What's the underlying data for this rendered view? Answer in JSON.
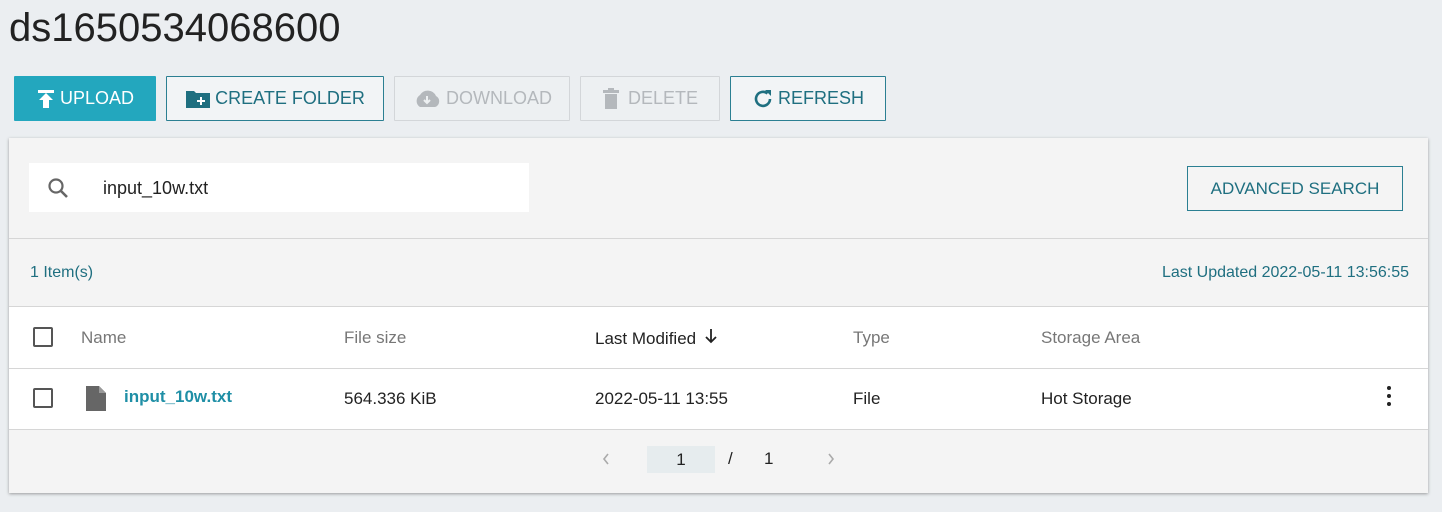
{
  "page": {
    "title": "ds1650534068600"
  },
  "toolbar": {
    "upload_label": "UPLOAD",
    "create_folder_label": "CREATE FOLDER",
    "download_label": "DOWNLOAD",
    "delete_label": "DELETE",
    "refresh_label": "REFRESH"
  },
  "search": {
    "value": "input_10w.txt",
    "advanced_label": "ADVANCED SEARCH",
    "icon": "search-icon"
  },
  "summary": {
    "item_count": "1 Item(s)",
    "last_updated": "Last Updated 2022-05-11 13:56:55"
  },
  "table": {
    "columns": {
      "name": "Name",
      "file_size": "File size",
      "last_modified": "Last Modified",
      "type": "Type",
      "storage_area": "Storage Area"
    },
    "sort_icon": "arrow-down-icon",
    "rows": [
      {
        "name": "input_10w.txt",
        "file_size": "564.336 KiB",
        "last_modified": "2022-05-11 13:55",
        "type": "File",
        "storage_area": "Hot Storage",
        "icon": "file-icon"
      }
    ]
  },
  "pagination": {
    "current": "1",
    "separator": "/",
    "total": "1"
  },
  "colors": {
    "accent": "#23a7be",
    "accent_text": "#1f6f80",
    "background": "#ebeef1"
  }
}
